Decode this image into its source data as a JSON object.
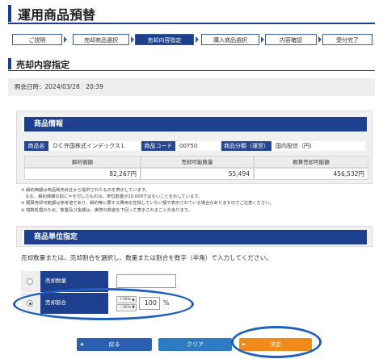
{
  "page_title": "運用商品預替",
  "steps": [
    "ご説明",
    "売却商品選択",
    "売却内容指定",
    "購入商品選択",
    "内容確認",
    "受付完了"
  ],
  "active_step": 2,
  "section_title": "売却内容指定",
  "reference_datetime": "照会日時：2024/03/28　20:39",
  "product_info": {
    "title": "商品情報",
    "name_label": "商品名",
    "name_value": "ＤＣ外国株式インデックスＬ",
    "code_label": "商品コード",
    "code_value": "00750",
    "category_label": "商品分類（運営）",
    "category_value": "国内投信（円）",
    "table_headers": [
      "解約価額",
      "売却可能数量",
      "概算売却可能額"
    ],
    "table_values": [
      "82,267円",
      "55,494",
      "456,532円"
    ]
  },
  "notes": [
    "※ 解約価額は商品販売会社から提供されたものを表示しています。",
    "　なお、解約価額の前に＊を付したものは、単位数量が10,000ではないことを示しています。",
    "※ 概算売却可能額は参考値であり、解約等に要する費用を控除していない額で表示されている場合がありますのでご注意ください。",
    "※ 端数処理のため、数量及び金額は、実際の数値を下回って表示されることがあります。"
  ],
  "unit_section": {
    "title": "商品単位指定",
    "instruction": "売却数量または、売却割合を選択し、数量または割合を数字（半角）で入力してください。",
    "quantity_label": "売却数量",
    "quantity_value": "",
    "ratio_label": "売却割合",
    "ratio_up": "＋10% ▲",
    "ratio_down": "－10% ▼",
    "ratio_value": "100",
    "ratio_unit": "%"
  },
  "buttons": {
    "back": "戻る",
    "clear": "クリア",
    "confirm": "決定"
  },
  "colors": {
    "primary_navy": "#1d3f8e",
    "back_button": "#2a5fb2",
    "clear_button": "#2d7bc0",
    "confirm_button": "#f08a1a",
    "annotation": "#1f5fbf"
  }
}
